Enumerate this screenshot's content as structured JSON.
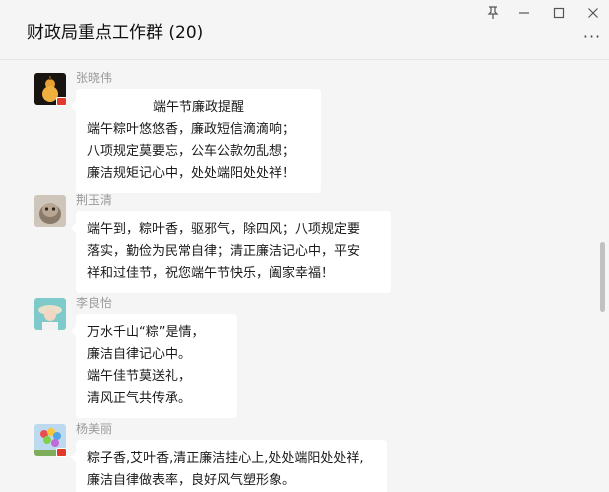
{
  "window": {
    "title": "财政局重点工作群 (20)",
    "controls": [
      "pin-icon",
      "minimize-icon",
      "maximize-icon",
      "close-icon"
    ],
    "more_icon": "more-icon"
  },
  "messages": [
    {
      "sender": "张晓伟",
      "lines": [
        "端午节廉政提醒",
        "端午粽叶悠悠香，廉政短信滴滴响；",
        "八项规定莫要忘，公车公款勿乱想；",
        "廉洁规矩记心中，处处端阳处处祥！"
      ]
    },
    {
      "sender": "荆玉清",
      "lines": [
        "端午到，粽叶香，驱邪气，除四风；八项规定要",
        "落实，勤俭为民常自律；清正廉洁记心中，平安",
        "祥和过佳节，祝您端午节快乐，阖家幸福！"
      ]
    },
    {
      "sender": "李良怡",
      "lines": [
        "万水千山“粽”是情，",
        "廉洁自律记心中。",
        "端午佳节莫送礼，",
        "清风正气共传承。"
      ]
    },
    {
      "sender": "杨美丽",
      "lines": [
        "粽子香,艾叶香,清正廉洁挂心上,处处端阳处处祥,",
        "廉洁自律做表率，良好风气塑形象。"
      ]
    }
  ],
  "colors": {
    "background": "#f5f5f5",
    "bubble": "#ffffff",
    "sender": "#9a9a9a",
    "flag": "#e03a2a"
  }
}
